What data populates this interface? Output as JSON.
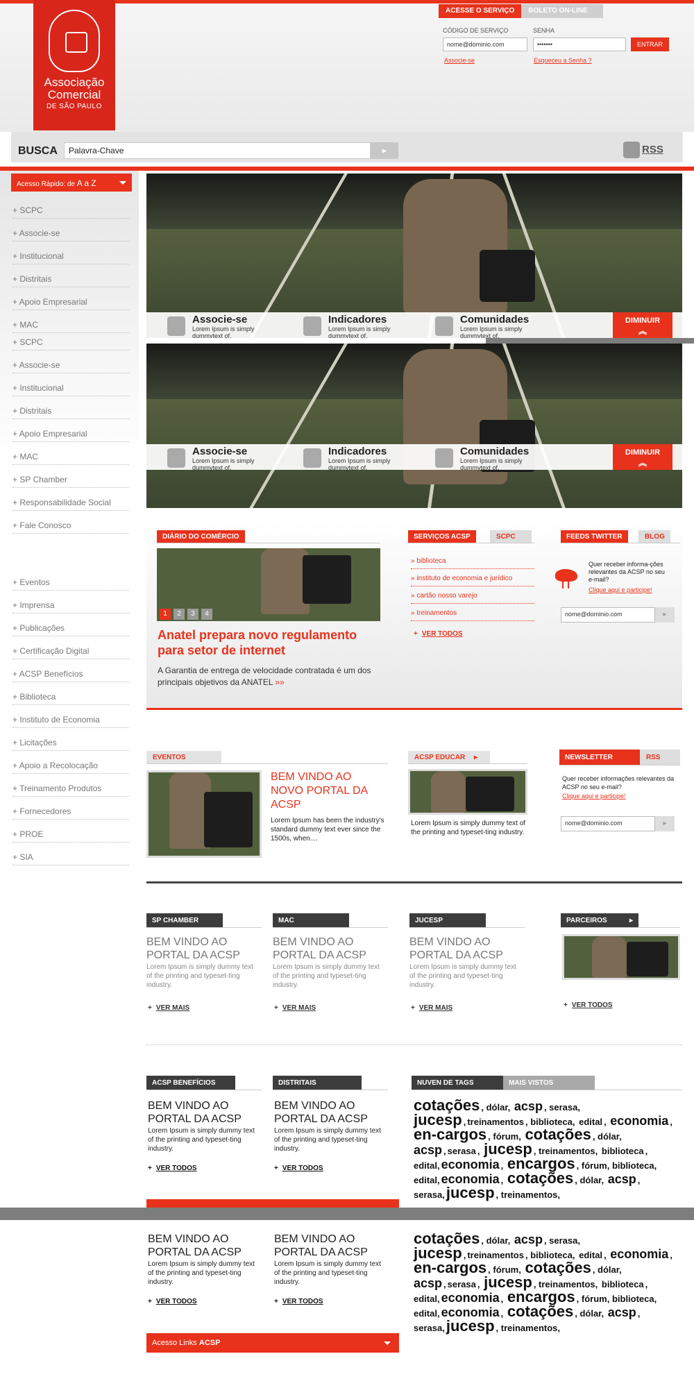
{
  "logo": {
    "line1": "Associação",
    "line2": "Comercial",
    "line3": "DE SÃO PAULO"
  },
  "login": {
    "tab_active": "ACESSE O SERVIÇO",
    "tab_other": "BOLETO ON-LINE",
    "code_label": "CÓDIGO DE SERVIÇO",
    "code_value": "nome@dominio.com",
    "password_label": "SENHA",
    "password_value": "•••••••",
    "submit": "ENTRAR",
    "associate_link": "Associe-se",
    "forgot_link": "Esqueceu a Senha ?"
  },
  "search": {
    "label": "BUSCA",
    "value": "Palavra-Chave",
    "rss": "RSS"
  },
  "sidebar": {
    "quick_prefix": "Acesso Rápido: de ",
    "quick_range": "A a Z",
    "group1": [
      "+ SCPC",
      "+ Associe-se",
      "+ Institucional",
      "+ Distritais",
      "+ Apoio Empresarial",
      "+ MAC"
    ],
    "group1_dup": [
      "+ SCPC",
      "+ Associe-se",
      "+ Institucional",
      "+ Distritais",
      "+ Apoio Empresarial",
      "+ MAC",
      "+ SP Chamber",
      "+ Responsabilidade Social",
      "+ Fale Conosco"
    ],
    "group2": [
      "+ Eventos",
      "+ Imprensa",
      "+ Publicações",
      "+ Certificação Digital",
      "+ ACSP Benefícios",
      "+ Biblioteca",
      "+ Instituto de Economia",
      "+ Licitações",
      "+ Apoio a Recolocação",
      "+ Treinamento Produtos",
      "+ Fornecedores",
      "+ PROE",
      "+ SIA"
    ]
  },
  "hero": {
    "items": [
      {
        "title": "Associe-se",
        "text": "Lorem Ipsum is simply dummytext of."
      },
      {
        "title": "Indicadores",
        "text": "Lorem Ipsum is simply dummytext of."
      },
      {
        "title": "Comunidades",
        "text": "Lorem Ipsum is simply dummytext of."
      }
    ],
    "collapse": "DIMINUIR"
  },
  "diario": {
    "header": "DIÁRIO DO COMÉRCIO",
    "pages": [
      "1",
      "2",
      "3",
      "4"
    ],
    "headline": "Anatel prepara novo regulamento para setor de internet",
    "summary": "A Garantia de entrega de velocidade contratada é um dos principais objetivos da ANATEL",
    "more": "»»"
  },
  "servicos": {
    "tab_active": "SERVIÇOS ACSP",
    "tab_other": "SCPC",
    "links": [
      "» biblioteca",
      "» instituto de economia e jurídico",
      "» cartão nosso varejo",
      "» treinamentos"
    ],
    "see_all": "VER TODOS"
  },
  "twitter": {
    "tab_active": "FEEDS TWITTER",
    "tab_other": "BLOG",
    "question": "Quer receber informa-ções relevantes da ACSP no seu e-mail?",
    "cta": "Clique aqui e participe!",
    "email": "nome@dominio.com"
  },
  "eventos": {
    "header": "EVENTOS",
    "title": "BEM VINDO AO NOVO PORTAL DA ACSP",
    "text": "Lorem Ipsum has been the industry's standard dummy text ever since the 1500s, when...."
  },
  "educar": {
    "header": "ACSP EDUCAR",
    "text": "Lorem Ipsum is simply dummy text of the printing and typeset-ting industry."
  },
  "newsletter": {
    "tab_active": "NEWSLETTER",
    "tab_other": "RSS",
    "question": "Quer receber informações relevantes da ACSP no seu e-mail?",
    "cta": "Clique aqui e participe!",
    "email": "nome@dominio.com"
  },
  "row3": {
    "cols": [
      {
        "header": "SP CHAMBER",
        "title": "BEM VINDO AO PORTAL DA ACSP",
        "text": "Lorem Ipsum is simply dummy text of the printing and typeset-ting industry.",
        "more": "VER MAIS"
      },
      {
        "header": "MAC",
        "title": "BEM VINDO AO PORTAL DA ACSP",
        "text": "Lorem Ipsum is simply dummy text of the printing and typeset-ting industry.",
        "more": "VER MAIS"
      },
      {
        "header": "JUCESP",
        "title": "BEM VINDO AO PORTAL DA ACSP",
        "text": "Lorem Ipsum is simply dummy text of the printing and typeset-ting industry.",
        "more": "VER MAIS"
      }
    ],
    "parceiros": {
      "header": "PARCEIROS",
      "more": "VER TODOS"
    }
  },
  "row4": {
    "cols": [
      {
        "header": "ACSP BENEFÍCIOS",
        "title": "BEM VINDO AO PORTAL DA ACSP",
        "text": "Lorem Ipsum is simply dummy text of the printing and typeset-ting industry.",
        "more": "VER TODOS"
      },
      {
        "header": "DISTRITAIS",
        "title": "BEM VINDO AO PORTAL DA ACSP",
        "text": "Lorem Ipsum is simply dummy text of the printing and typeset-ting industry.",
        "more": "VER TODOS"
      }
    ],
    "tags_tab_active": "NUVEN DE TAGS",
    "tags_tab_other": "MAIS VISTOS",
    "links_bar": "Acesso Links ",
    "links_bar_bold": "ACSP"
  },
  "tags": [
    [
      "cotações",
      "t1"
    ],
    [
      ", dólar, ",
      "t3"
    ],
    [
      "acsp",
      "t2"
    ],
    [
      ", serasa, ",
      "t3"
    ],
    [
      "jucesp",
      "t1"
    ],
    [
      ",",
      "t3"
    ],
    [
      "treinamentos",
      "t3"
    ],
    [
      ", biblioteca, ",
      "t3"
    ],
    [
      "edital",
      "t3"
    ],
    [
      ", ",
      "t3"
    ],
    [
      "economia",
      "t2"
    ],
    [
      ", ",
      "t3"
    ],
    [
      "en-cargos",
      "t1"
    ],
    [
      ", fórum, ",
      "t3"
    ],
    [
      "cotações",
      "t1"
    ],
    [
      ", dólar, ",
      "t3"
    ],
    [
      "acsp",
      "t2"
    ],
    [
      ",",
      "t3"
    ],
    [
      "serasa",
      "t3"
    ],
    [
      ", ",
      "t3"
    ],
    [
      "jucesp",
      "t1"
    ],
    [
      ", treinamentos, ",
      "t3"
    ],
    [
      "biblioteca",
      "t3"
    ],
    [
      ", edital,",
      "t3"
    ],
    [
      "economia",
      "t2"
    ],
    [
      ", ",
      "t3"
    ],
    [
      "encargos",
      "t1"
    ],
    [
      ", fórum, biblioteca, edital,",
      "t3"
    ],
    [
      "economia",
      "t2"
    ],
    [
      ", ",
      "t3"
    ],
    [
      "cotações",
      "t1"
    ],
    [
      ", dólar, ",
      "t3"
    ],
    [
      "acsp",
      "t2"
    ],
    [
      ", serasa,",
      "t3"
    ],
    [
      "jucesp",
      "t1"
    ],
    [
      ", treinamentos,",
      "t3"
    ]
  ]
}
